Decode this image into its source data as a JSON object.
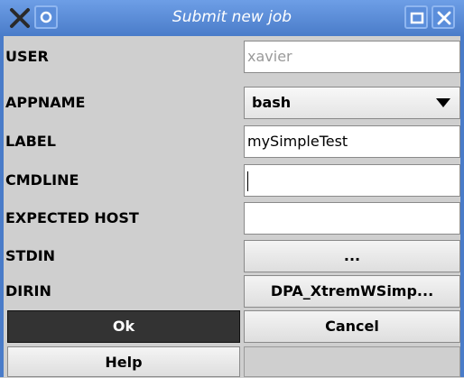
{
  "window": {
    "title": "Submit new job"
  },
  "form": {
    "user_label": "USER",
    "user_value": "xavier",
    "appname_label": "APPNAME",
    "appname_value": "bash",
    "label_label": "LABEL",
    "label_value": "mySimpleTest",
    "cmdline_label": "CMDLINE",
    "cmdline_value": "",
    "expected_host_label": "EXPECTED HOST",
    "expected_host_value": "",
    "stdin_label": "STDIN",
    "stdin_button": "...",
    "dirin_label": "DIRIN",
    "dirin_button": "DPA_XtremWSimp..."
  },
  "buttons": {
    "ok": "Ok",
    "cancel": "Cancel",
    "help": "Help"
  },
  "colors": {
    "titlebar": "#4a7cc9",
    "background": "#cfcfcf",
    "ok_button": "#333333"
  },
  "icons": {
    "titlebar_left": [
      "close-x-icon",
      "menu-icon"
    ],
    "titlebar_right": [
      "maximize-icon",
      "close-icon"
    ],
    "dropdown": "triangle-down-icon"
  }
}
